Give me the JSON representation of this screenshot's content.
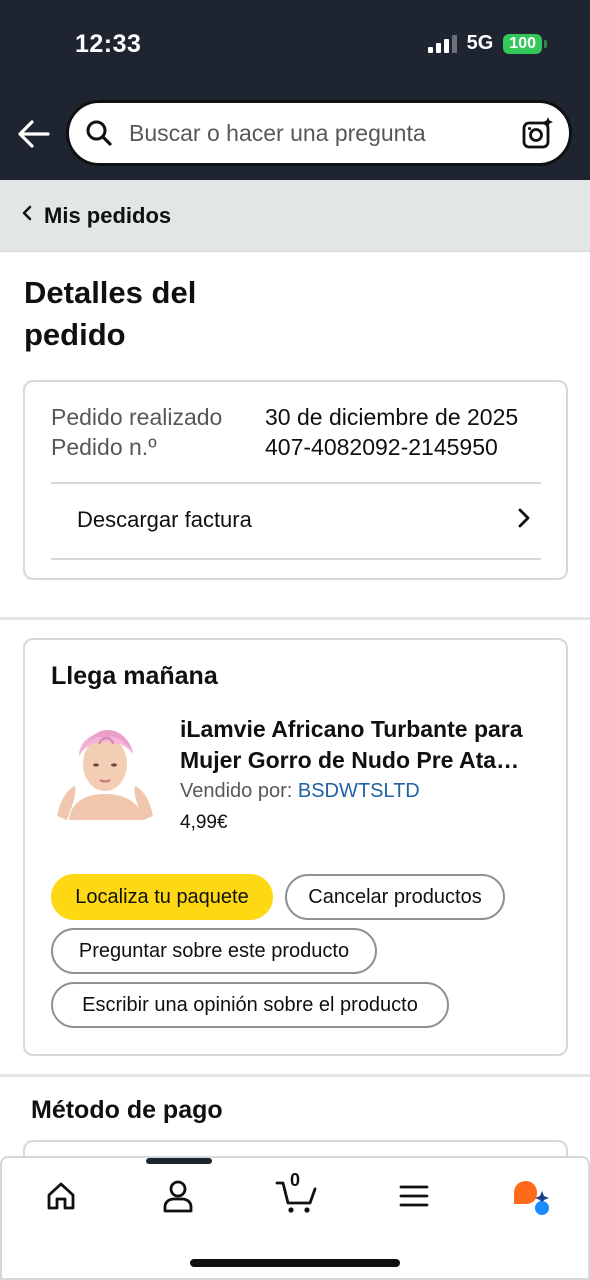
{
  "status_bar": {
    "time": "12:33",
    "network": "5G",
    "battery": "100"
  },
  "search": {
    "placeholder": "Buscar o hacer una pregunta"
  },
  "breadcrumb": {
    "label": "Mis pedidos"
  },
  "page": {
    "title": "Detalles del pedido"
  },
  "order_info": {
    "placed_label": "Pedido realizado",
    "placed_value": "30 de diciembre de 2025",
    "number_label": "Pedido n.º",
    "number_value": "407-4082092-2145950",
    "invoice_label": "Descargar factura"
  },
  "shipment": {
    "status": "Llega mañana",
    "product_title": "iLamvie Africano Turbante para Mujer Gorro de Nudo Pre Ata…",
    "seller_prefix": "Vendido por: ",
    "seller_name": "BSDWTSLTD",
    "price": "4,99€",
    "buttons": {
      "track": "Localiza tu paquete",
      "cancel": "Cancelar productos",
      "ask": "Preguntar sobre este producto",
      "review": "Escribir una opinión sobre el producto"
    }
  },
  "payment": {
    "title": "Método de pago"
  },
  "bottom_nav": {
    "cart_count": "0",
    "items": [
      "home-icon",
      "account-icon",
      "cart-icon",
      "menu-icon",
      "rufus-icon"
    ]
  },
  "colors": {
    "header_bg": "#1e2430",
    "primary_button": "#ffd814",
    "link": "#2162a1",
    "battery": "#34c759"
  }
}
